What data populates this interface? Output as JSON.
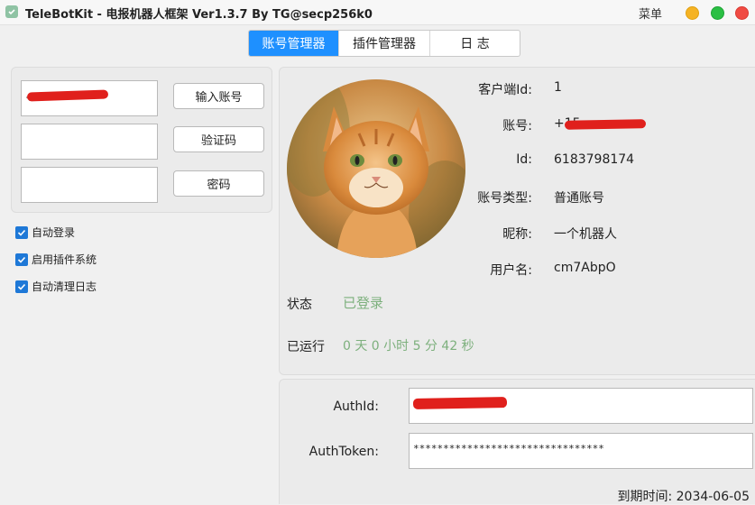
{
  "window": {
    "title": "TeleBotKit - 电报机器人框架 Ver1.3.7 By TG@secp256k0",
    "menu_label": "菜单",
    "controls": [
      "minimize",
      "maximize",
      "close"
    ]
  },
  "tabs": [
    {
      "label": "账号管理器",
      "active": true
    },
    {
      "label": "插件管理器",
      "active": false
    },
    {
      "label": "日 志",
      "active": false
    }
  ],
  "login": {
    "account_value": "+",
    "account_button": "输入账号",
    "code_value": "",
    "code_button": "验证码",
    "password_value": "",
    "password_button": "密码"
  },
  "options": [
    {
      "label": "自动登录",
      "checked": true
    },
    {
      "label": "启用插件系统",
      "checked": true
    },
    {
      "label": "自动清理日志",
      "checked": true
    }
  ],
  "profile": {
    "fields": [
      {
        "label": "客户端Id:",
        "value": "1"
      },
      {
        "label": "账号:",
        "value": "+15"
      },
      {
        "label": "Id:",
        "value": "6183798174"
      },
      {
        "label": "账号类型:",
        "value": "普通账号"
      },
      {
        "label": "昵称:",
        "value": "一个机器人"
      },
      {
        "label": "用户名:",
        "value": "cm7AbpO"
      }
    ],
    "status_label": "状态",
    "status_value": "已登录",
    "runtime_label": "已运行",
    "runtime_value": "0 天 0 小时 5 分 42 秒"
  },
  "auth": {
    "authid_label": "AuthId:",
    "authid_value": "",
    "authtoken_label": "AuthToken:",
    "authtoken_value": "********************************",
    "expiry_label": "到期时间:",
    "expiry_value": "2034-06-05"
  },
  "colors": {
    "accent": "#1e90ff",
    "status_green": "#7db07d",
    "redaction": "#e0201c"
  }
}
